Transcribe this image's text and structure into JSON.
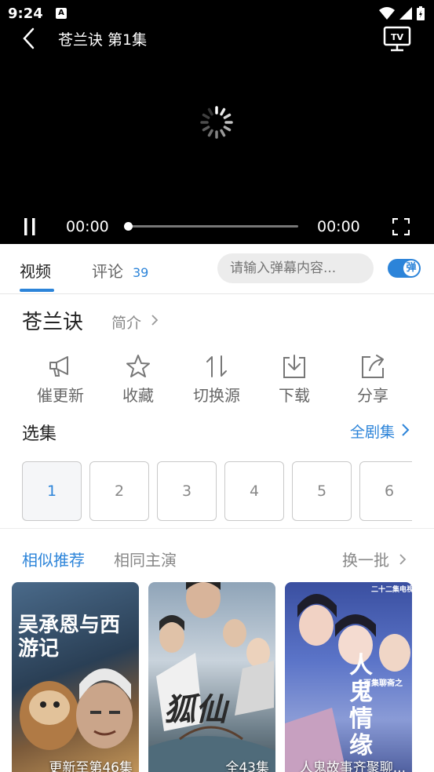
{
  "status_bar": {
    "time": "9:24",
    "notification_badge": "A"
  },
  "player": {
    "title": "苍兰诀 第1集",
    "current_time": "00:00",
    "total_time": "00:00",
    "progress": 0,
    "tv_label": "TV"
  },
  "tabs": {
    "video": "视频",
    "comments": "评论",
    "comment_count": "39"
  },
  "danmaku": {
    "placeholder": "请输入弹幕内容...",
    "toggle_label": "弹",
    "enabled": true
  },
  "show": {
    "title": "苍兰诀",
    "intro_label": "简介"
  },
  "actions": [
    {
      "label": "催更新",
      "icon": "megaphone-icon"
    },
    {
      "label": "收藏",
      "icon": "star-icon"
    },
    {
      "label": "切换源",
      "icon": "switch-icon"
    },
    {
      "label": "下载",
      "icon": "download-icon"
    },
    {
      "label": "分享",
      "icon": "share-icon"
    }
  ],
  "episodes": {
    "title": "选集",
    "all_label": "全剧集",
    "items": [
      "1",
      "2",
      "3",
      "4",
      "5",
      "6"
    ],
    "selected": "1"
  },
  "recommend": {
    "tab_similar": "相似推荐",
    "tab_same_cast": "相同主演",
    "refresh_label": "换一批"
  },
  "cards": [
    {
      "caption": "更新至第46集",
      "poster_text": "吴承恩与西游记"
    },
    {
      "caption": "全43集",
      "poster_text": "狐仙"
    },
    {
      "caption": "人鬼故事齐聚聊...",
      "poster_text": "人鬼情缘",
      "poster_top_text": "二十二集电视连续剧",
      "poster_tagline": "百集聊斋之"
    }
  ],
  "colors": {
    "accent": "#2c84d9",
    "player_bg": "#000000",
    "text_dark": "#222222",
    "text_grey": "#888888"
  }
}
